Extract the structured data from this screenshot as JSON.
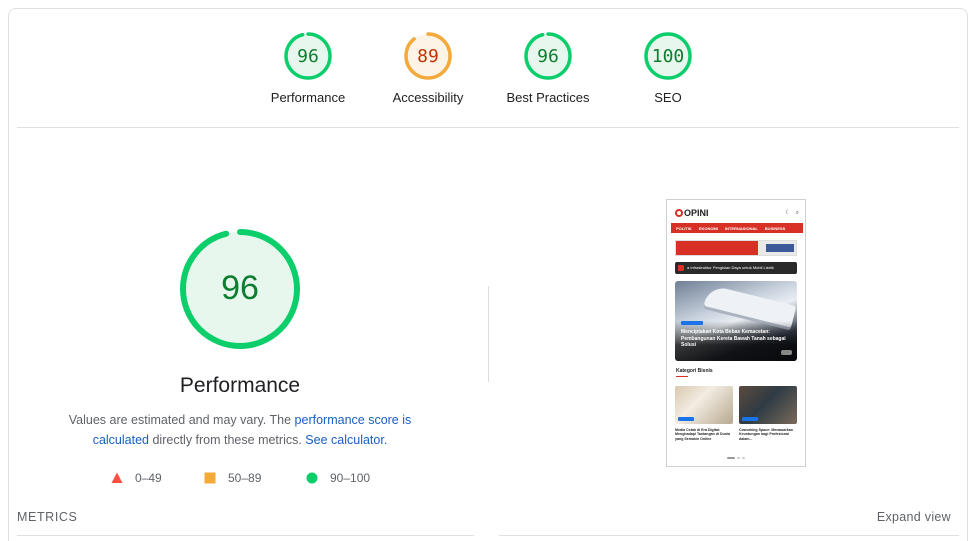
{
  "gauges": [
    {
      "score": "96",
      "label": "Performance",
      "status": "pass",
      "fraction": 0.96
    },
    {
      "score": "89",
      "label": "Accessibility",
      "status": "average",
      "fraction": 0.89
    },
    {
      "score": "96",
      "label": "Best Practices",
      "status": "pass",
      "fraction": 0.96
    },
    {
      "score": "100",
      "label": "SEO",
      "status": "pass",
      "fraction": 1.0
    }
  ],
  "colors": {
    "pass": "#0cce6b",
    "pass_text": "#0d7d2f",
    "pass_bg": "#e8f7ee",
    "average": "#f4a93b",
    "average_text": "#c33300",
    "average_bg": "#fdf3e6",
    "fail": "#ff4e42",
    "link": "#1a5fc2"
  },
  "main": {
    "score": "96",
    "fraction": 0.96,
    "title": "Performance",
    "desc_prefix": "Values are estimated and may vary. The ",
    "desc_link1": "performance score is calculated",
    "desc_middle": " directly from these metrics. ",
    "desc_link2": "See calculator."
  },
  "legend": [
    {
      "shape": "triangle",
      "range": "0–49"
    },
    {
      "shape": "square",
      "range": "50–89"
    },
    {
      "shape": "circle",
      "range": "90–100"
    }
  ],
  "screenshot": {
    "logo": "OPINI",
    "nav": [
      "POLITIK",
      "EKONOMI",
      "INTERNASIONAL",
      "BUSINESS"
    ],
    "ticker": "a Infrastruktur Pengisian Daya untuk Mobil Listrik",
    "hero_caption": "Menciptakan Kota Bebas Kemacetan: Pembangunan Kereta Bawah Tanah sebagai Solusi",
    "section_title": "Kategori Bisnis",
    "card1_text": "Media Cetak di Era Digital: Menghadapi Tantangan di Dunia yang Semakin Online",
    "card2_text": "Coworking Space: Menawarkan Keuntungan bagi Profesional dalam..."
  },
  "metrics": {
    "label": "METRICS",
    "expand": "Expand view"
  }
}
